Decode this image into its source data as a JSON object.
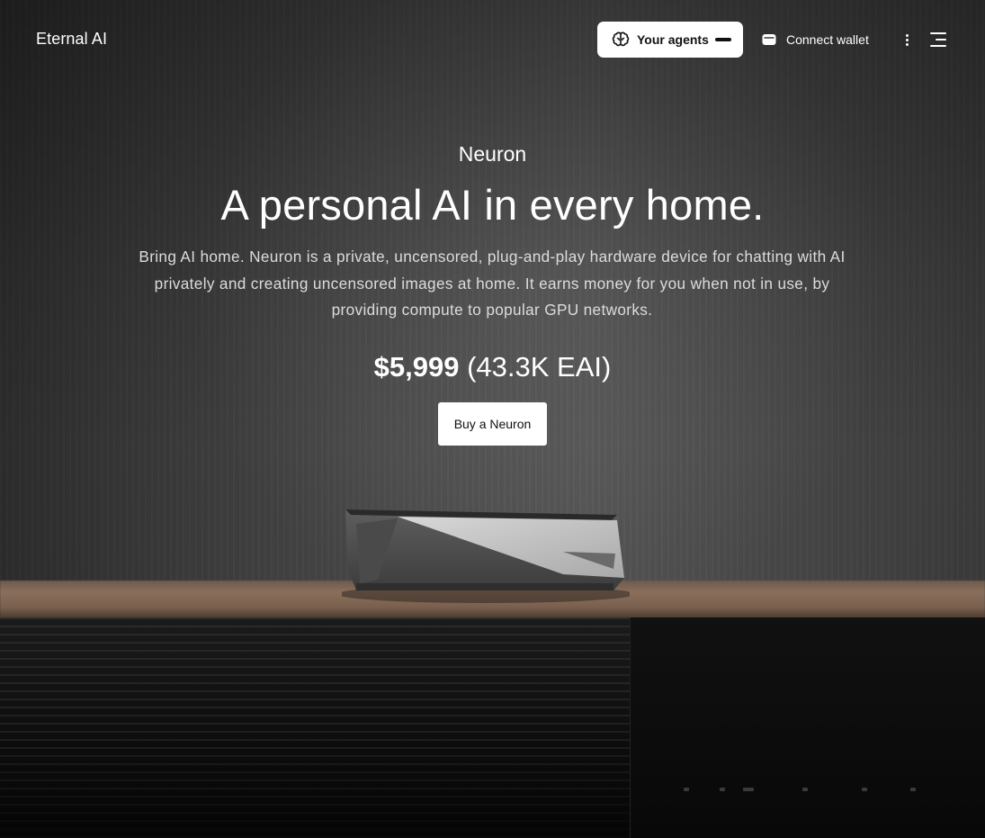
{
  "header": {
    "brand": "Eternal AI",
    "agents_button": {
      "label": "Your agents",
      "icon": "brain-icon"
    },
    "wallet_button": {
      "label": "Connect wallet",
      "icon": "wallet-icon"
    },
    "more_icon": "kebab-menu-icon",
    "menu_icon": "hamburger-menu-icon"
  },
  "hero": {
    "eyebrow": "Neuron",
    "headline": "A personal AI in every home.",
    "description": "Bring AI home. Neuron is a private, uncensored, plug-and-play hardware device for chatting with AI privately and creating uncensored images at home. It earns money for you when not in use, by providing compute to popular GPU networks.",
    "price_usd": "$5,999",
    "price_token": "(43.3K EAI)",
    "cta_label": "Buy a Neuron"
  },
  "colors": {
    "button_bg": "#ffffff",
    "button_text": "#111111",
    "text": "#ffffff"
  }
}
